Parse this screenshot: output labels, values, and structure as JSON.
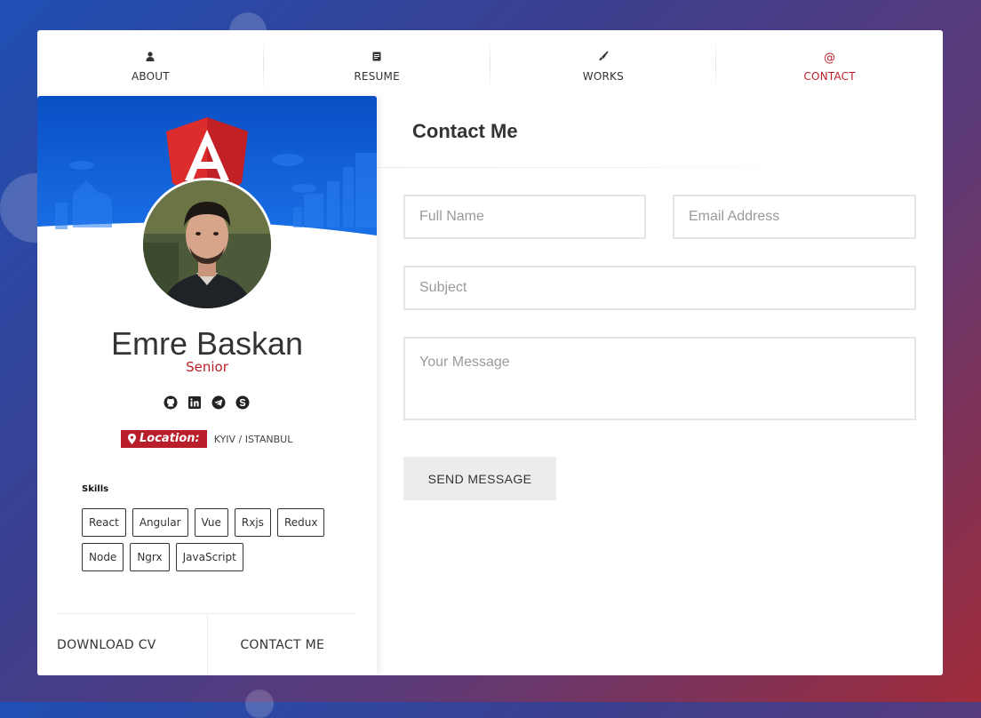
{
  "nav": {
    "items": [
      {
        "label": "ABOUT",
        "icon": "user-icon"
      },
      {
        "label": "RESUME",
        "icon": "document-icon"
      },
      {
        "label": "WORKS",
        "icon": "brush-icon"
      },
      {
        "label": "CONTACT",
        "icon": "at-icon",
        "glyph": "@"
      }
    ],
    "active": "CONTACT"
  },
  "profile": {
    "name": "Emre Baskan",
    "role": "Senior",
    "socials": [
      "github-icon",
      "linkedin-icon",
      "telegram-icon",
      "skype-icon"
    ],
    "location_label": "Location:",
    "location_value": "KYIV / ISTANBUL",
    "skills_title": "Skills",
    "skills": [
      "React",
      "Angular",
      "Vue",
      "Rxjs",
      "Redux",
      "Node",
      "Ngrx",
      "JavaScript"
    ],
    "download_cv": "DOWNLOAD CV",
    "contact_me": "CONTACT ME"
  },
  "contact": {
    "title": "Contact Me",
    "full_name_placeholder": "Full Name",
    "email_placeholder": "Email Address",
    "subject_placeholder": "Subject",
    "message_placeholder": "Your Message",
    "send_label": "SEND MESSAGE"
  },
  "colors": {
    "accent": "#b81f2a",
    "banner": "#0d5bd1"
  }
}
